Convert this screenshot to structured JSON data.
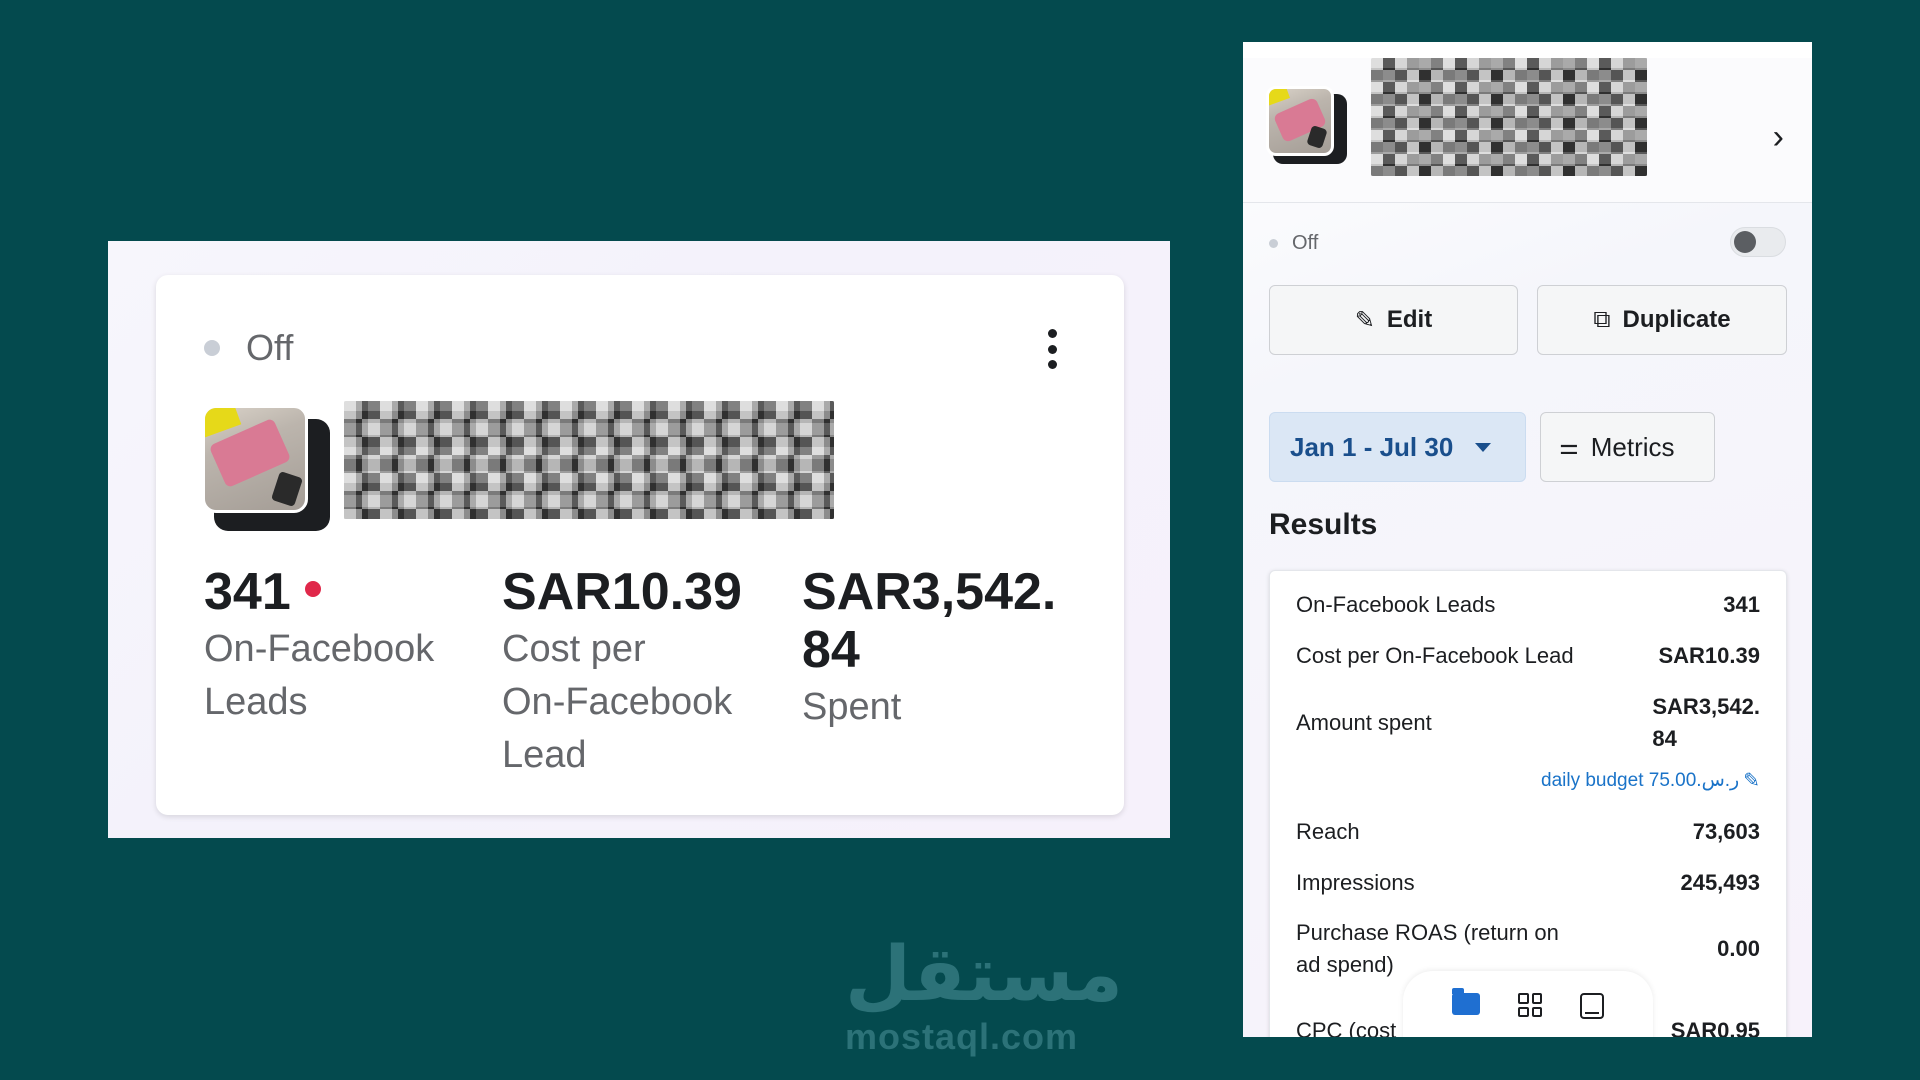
{
  "left_card": {
    "status": "Off",
    "metrics": [
      {
        "value": "341",
        "label_line1": "On-Facebook",
        "label_line2": "Leads",
        "label_line3": ""
      },
      {
        "value": "SAR10.39",
        "label_line1": "Cost per",
        "label_line2": "On-Facebook",
        "label_line3": "Lead"
      },
      {
        "value_line1": "SAR3,542.",
        "value_line2": "84",
        "label": "Spent"
      }
    ]
  },
  "right_panel": {
    "status": "Off",
    "edit_label": "Edit",
    "duplicate_label": "Duplicate",
    "date_range": "Jan 1 - Jul 30",
    "metrics_label": "Metrics",
    "results_title": "Results",
    "results": [
      {
        "key": "On-Facebook Leads",
        "value": "341"
      },
      {
        "key": "Cost per On-Facebook Lead",
        "value": "SAR10.39"
      },
      {
        "key": "Amount spent",
        "value_line1": "SAR3,542.",
        "value_line2": "84"
      },
      {
        "key": "Reach",
        "value": "73,603"
      },
      {
        "key": "Impressions",
        "value": "245,493"
      },
      {
        "key_line1": "Purchase ROAS (return on",
        "key_line2": "ad spend)",
        "value": "0.00"
      },
      {
        "key": "CPC (cost",
        "value": "SAR0.95"
      }
    ],
    "budget_text": "daily budget 75.00.ر.س",
    "bottom_icons": [
      "folder-icon",
      "grid-icon",
      "tablet-icon"
    ]
  },
  "watermark": {
    "logo_text": "مستقل",
    "site": "mostaql.com"
  },
  "colors": {
    "background": "#044a4e",
    "accent_blue": "#1a4f8c",
    "link_blue": "#1a73c8",
    "red_dot": "#e0284a"
  }
}
